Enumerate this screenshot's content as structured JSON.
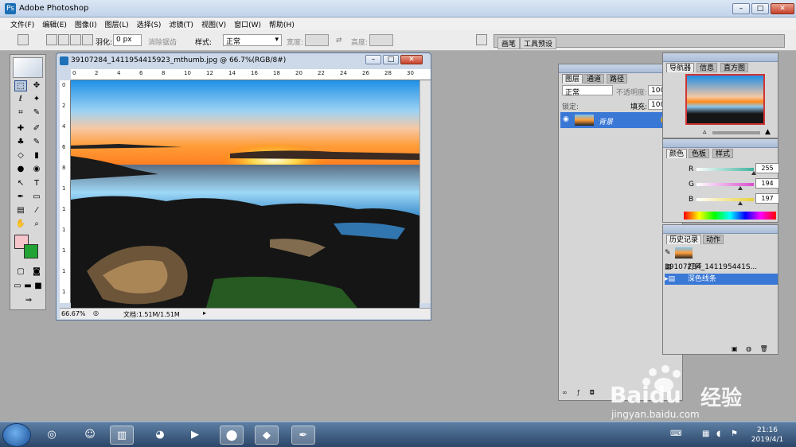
{
  "app": {
    "title": "Adobe Photoshop",
    "logo_letter": "Ps"
  },
  "window_controls": {
    "minimize": "–",
    "restore": "□",
    "close": "✕"
  },
  "menubar": [
    "文件(F)",
    "编辑(E)",
    "图像(I)",
    "图层(L)",
    "选择(S)",
    "滤镜(T)",
    "视图(V)",
    "窗口(W)",
    "帮助(H)"
  ],
  "options": {
    "feather_label": "羽化:",
    "feather_value": "0 px",
    "antialias_label": "消除锯齿",
    "style_label": "样式:",
    "style_value": "正常",
    "width_label": "宽度:",
    "height_label": "高度:",
    "palette_well_tabs": [
      "画笔",
      "工具预设"
    ]
  },
  "document": {
    "title": "39107284_1411954415923_mthumb.jpg @ 66.7%(RGB/8#)",
    "zoom": "66.67%",
    "doc_info": "文档:1.51M/1.51M",
    "ruler_h": [
      "0",
      "2",
      "4",
      "6",
      "8",
      "10",
      "12",
      "14",
      "16",
      "18",
      "20",
      "22",
      "24",
      "26",
      "28",
      "30"
    ],
    "ruler_v": [
      "0",
      "2",
      "4",
      "6",
      "8",
      "1",
      "1",
      "1",
      "1",
      "1",
      "1"
    ]
  },
  "layers_panel": {
    "tabs": [
      "图层",
      "通道",
      "路径"
    ],
    "blend_mode": "正常",
    "opacity_label": "不透明度:",
    "opacity_value": "100%",
    "lock_label": "锁定:",
    "fill_label": "填充:",
    "fill_value": "100%",
    "layer_name": "背景"
  },
  "navigator_panel": {
    "tabs": [
      "导航器",
      "信息",
      "直方图"
    ]
  },
  "color_panel": {
    "tabs": [
      "颜色",
      "色板",
      "样式"
    ],
    "channels": [
      {
        "label": "R",
        "value": "255",
        "level": 1.0,
        "color": "#3fb39e"
      },
      {
        "label": "G",
        "value": "194",
        "level": 0.76,
        "color": "#d94fd0"
      },
      {
        "label": "B",
        "value": "197",
        "level": 0.77,
        "color": "#e7d13a"
      }
    ]
  },
  "history_panel": {
    "tabs": [
      "历史记录",
      "动作"
    ],
    "snapshot": "39107284_141195441S...",
    "items": [
      "打开",
      "深色线条"
    ],
    "selected_index": 1
  },
  "taskbar": {
    "time": "21:16",
    "date": "2019/4/1",
    "apps": [
      "360-icon",
      "qq-icon",
      "folder-icon",
      "firefox-icon",
      "media-icon",
      "recorder-icon",
      "notes-icon",
      "photoshop-icon"
    ]
  },
  "watermark": {
    "brand": "Baidu",
    "brand_cn": "经验",
    "url": "jingyan.baidu.com"
  }
}
